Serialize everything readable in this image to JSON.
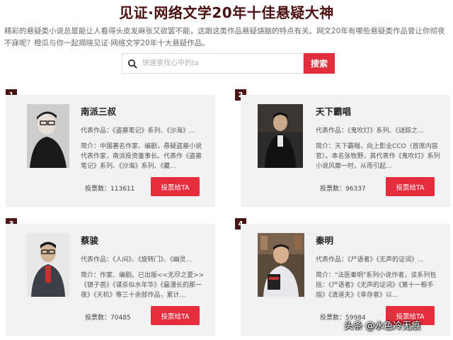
{
  "page": {
    "title": "见证·网络文学20年十佳悬疑大神",
    "intro": "精彩的悬疑类小说总是能让人看得头皮发麻张又欲罢不能，这跟这类作品悬疑烧脑的特点有关。网文20年有哪些悬疑类作品曾让你彻夜不寐呢？橙瓜与你一起揭晓见证·网络文学20年十大悬疑作品。"
  },
  "search": {
    "placeholder": "快速查找心中的ta",
    "button_label": "搜索"
  },
  "authors": [
    {
      "rank": "1",
      "name": "南派三叔",
      "works": "代表作品：《盗墓笔记》系列、《沙海》...",
      "bio": "简介：中国著名作家、编剧，悬疑盗墓小说代表作家，南派投资董事长。代表作《盗墓笔记》系列、《沙海》系列、《藏...",
      "votes_label": "投票数：",
      "votes": "113611",
      "vote_button": "投票给TA"
    },
    {
      "rank": "2",
      "name": "天下霸唱",
      "works": "代表作品：《鬼吹灯》系列、《谜踪之...",
      "bio": "简介：天下霸唱，向上影业CCO（首席内容官）。本名张牧野，其代表作《鬼吹灯》系列小说风靡一时，从而引起...",
      "votes_label": "投票数：",
      "votes": "96337",
      "vote_button": "投票给TA"
    },
    {
      "rank": "3",
      "name": "蔡骏",
      "works": "代表作品：《人间》、《旋转门》、《幽灵...",
      "bio": "简介：作家、编剧。已出版<<无尽之夏>>《镜子兽》《谋杀似水年华》《最漫长的那一夜》《天机》等三十余部作品，累计...",
      "votes_label": "投票数：",
      "votes": "70485",
      "vote_button": "投票给TA"
    },
    {
      "rank": "4",
      "name": "秦明",
      "works": "代表作品：《尸语者》《无声的证词》...",
      "bio": "简介：\"法医秦明\"系列小说作者，该系列包括：《尸语者》《无声的证词》《第十一根手指》《清道夫》《幸存者》以...",
      "votes_label": "投票数：",
      "votes": "59984",
      "vote_button": "投票给TA"
    }
  ],
  "watermark": "头条 @水色冷无痕",
  "colors": {
    "title": "#4a1010",
    "accent_red": "#e22d3c",
    "badge": "#4a1414",
    "card_bg": "#f2f2f2"
  }
}
